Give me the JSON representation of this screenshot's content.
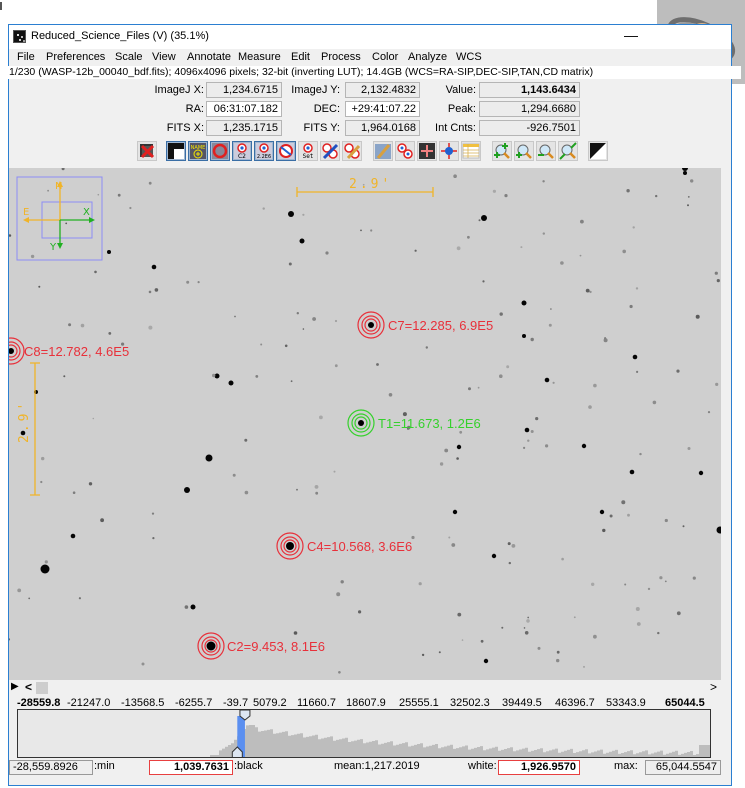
{
  "window": {
    "title": "Reduced_Science_Files (V) (35.1%)",
    "minimize_label": "—"
  },
  "menu": [
    "File",
    "Preferences",
    "Scale",
    "View",
    "Annotate",
    "Measure",
    "Edit",
    "Process",
    "Color",
    "Analyze",
    "WCS"
  ],
  "info_line": "1/230 (WASP-12b_00040_bdf.fits); 4096x4096 pixels; 32-bit (inverting LUT); 14.4GB (WCS=RA-SIP,DEC-SIP,TAN,CD matrix)",
  "readouts": {
    "imagej_x": {
      "label": "ImageJ X:",
      "value": "1,234.6715"
    },
    "imagej_y": {
      "label": "ImageJ Y:",
      "value": "2,132.4832"
    },
    "value": {
      "label": "Value:",
      "value": "1,143.6434"
    },
    "ra": {
      "label": "RA:",
      "value": "06:31:07.182"
    },
    "dec": {
      "label": "DEC:",
      "value": "+29:41:07.22"
    },
    "peak": {
      "label": "Peak:",
      "value": "1,294.6680"
    },
    "fits_x": {
      "label": "FITS X:",
      "value": "1,235.1715"
    },
    "fits_y": {
      "label": "FITS Y:",
      "value": "1,964.0168"
    },
    "int_cnts": {
      "label": "Int Cnts:",
      "value": "-926.7501"
    }
  },
  "toolbar": [
    {
      "name": "clear-overlay",
      "icon": "clear-overlay-icon",
      "text": ""
    },
    {
      "name": "invert",
      "icon": "invert-icon",
      "text": ""
    },
    {
      "name": "show-name",
      "icon": "name-icon",
      "text": "NAME"
    },
    {
      "name": "aperture-rings",
      "icon": "aperture-rings-icon",
      "text": ""
    },
    {
      "name": "centroid-c2",
      "icon": "centroid-icon",
      "text": "C2"
    },
    {
      "name": "centroid-value",
      "icon": "centroid-value-icon",
      "text": "2.2E6"
    },
    {
      "name": "remove-aperture",
      "icon": "remove-aperture-icon",
      "text": ""
    },
    {
      "name": "set-aperture",
      "icon": "set-aperture-icon",
      "text": "Set"
    },
    {
      "name": "edit-apertures",
      "icon": "edit-apertures-icon",
      "text": ""
    },
    {
      "name": "clear-apertures",
      "icon": "clear-apertures-icon",
      "text": ""
    },
    {
      "name": "clear-table",
      "icon": "broom-icon",
      "text": ""
    },
    {
      "name": "multi-aperture",
      "icon": "multi-aperture-icon",
      "text": ""
    },
    {
      "name": "align",
      "icon": "align-icon",
      "text": ""
    },
    {
      "name": "crosshair",
      "icon": "crosshair-icon",
      "text": ""
    },
    {
      "name": "table",
      "icon": "table-icon",
      "text": ""
    },
    {
      "name": "zoom-in-fast",
      "icon": "zoom-in-fast-icon",
      "text": ""
    },
    {
      "name": "zoom-in",
      "icon": "zoom-in-icon",
      "text": ""
    },
    {
      "name": "zoom-out",
      "icon": "zoom-out-icon",
      "text": ""
    },
    {
      "name": "zoom-fit",
      "icon": "zoom-fit-icon",
      "text": ""
    },
    {
      "name": "contrast",
      "icon": "contrast-icon",
      "text": ""
    }
  ],
  "overlay": {
    "compass": {
      "n": "N",
      "e": "E",
      "x": "X",
      "y": "Y"
    },
    "scale_h": "2.9'",
    "scale_v": "2.9'",
    "apertures": [
      {
        "label": "C7=12.285, 6.9E5",
        "color": "#e8303a"
      },
      {
        "label": "C8=12.782, 4.6E5",
        "color": "#e8303a"
      },
      {
        "label": "T1=11.673, 1.2E6",
        "color": "#35d12c"
      },
      {
        "label": "C4=10.568, 3.6E6",
        "color": "#e8303a"
      },
      {
        "label": "C2=9.453, 8.1E6",
        "color": "#e8303a"
      }
    ]
  },
  "scrollbar": {
    "left": "<",
    "right": ">"
  },
  "histogram": {
    "ticks": [
      "-28559.8",
      "-21247.0",
      "-13568.5",
      "-6255.7",
      "-39.7",
      "5079.2",
      "11660.7",
      "18607.9",
      "25555.1",
      "32502.3",
      "39449.5",
      "46396.7",
      "53343.9",
      "65044.5"
    ],
    "min": {
      "value": "-28,559.8926",
      "label": ":min"
    },
    "black": {
      "value": "1,039.7631",
      "label": ":black"
    },
    "mean": "mean:1,217.2019",
    "white": {
      "label": "white:",
      "value": "1,926.9570"
    },
    "max": {
      "label": "max:",
      "value": "65,044.5547"
    },
    "black_fraction": 0.316,
    "white_fraction": 0.327
  },
  "colors": {
    "accent": "#2b7fd1",
    "aperture_red": "#e8303a",
    "aperture_green": "#35d12c",
    "annotation_orange": "#f0b429",
    "compass_blue": "#8c8cf5"
  }
}
